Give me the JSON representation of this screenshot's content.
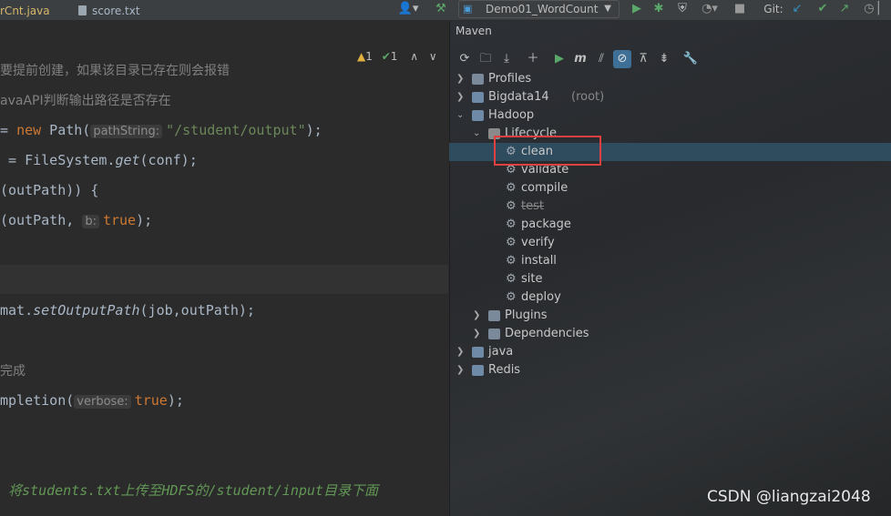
{
  "tabs": [
    {
      "label": "rCnt.java"
    },
    {
      "label": "score.txt"
    }
  ],
  "toolbar": {
    "run_config": "Demo01_WordCount",
    "git_label": "Git:"
  },
  "editor": {
    "inspections": {
      "warnings": "1",
      "checks": "1"
    },
    "lines": {
      "l1_comment": "要提前创建，如果该目录已存在则会报错",
      "l2_comment": "avaAPI判断输出路径是否存在",
      "l3_a": "= ",
      "l3_kw": "new",
      "l3_b": " Path(",
      "l3_hint": "pathString:",
      "l3_str": "\"/student/output\"",
      "l3_c": ");",
      "l4_a": " = FileSystem.",
      "l4_fn": "get",
      "l4_b": "(conf);",
      "l5": "(outPath)) {",
      "l6_a": "(outPath, ",
      "l6_hint": "b:",
      "l6_kw": "true",
      "l6_b": ");",
      "l7_a": "mat.",
      "l7_fn": "setOutputPath",
      "l7_b": "(job,outPath);",
      "l8_comment": "完成",
      "l9_a": "mpletion(",
      "l9_hint": "verbose:",
      "l9_kw": "true",
      "l9_b": ");",
      "l10_doc": " 将students.txt上传至HDFS的/student/input目录下面"
    }
  },
  "maven": {
    "title": "Maven",
    "tree": {
      "profiles": "Profiles",
      "bigdata14": "Bigdata14",
      "bigdata14_suffix": "(root)",
      "hadoop": "Hadoop",
      "lifecycle": "Lifecycle",
      "phases": [
        "clean",
        "validate",
        "compile",
        "test",
        "package",
        "verify",
        "install",
        "site",
        "deploy"
      ],
      "plugins": "Plugins",
      "dependencies": "Dependencies",
      "java": "java",
      "redis": "Redis"
    }
  },
  "watermark": "CSDN @liangzai2048"
}
